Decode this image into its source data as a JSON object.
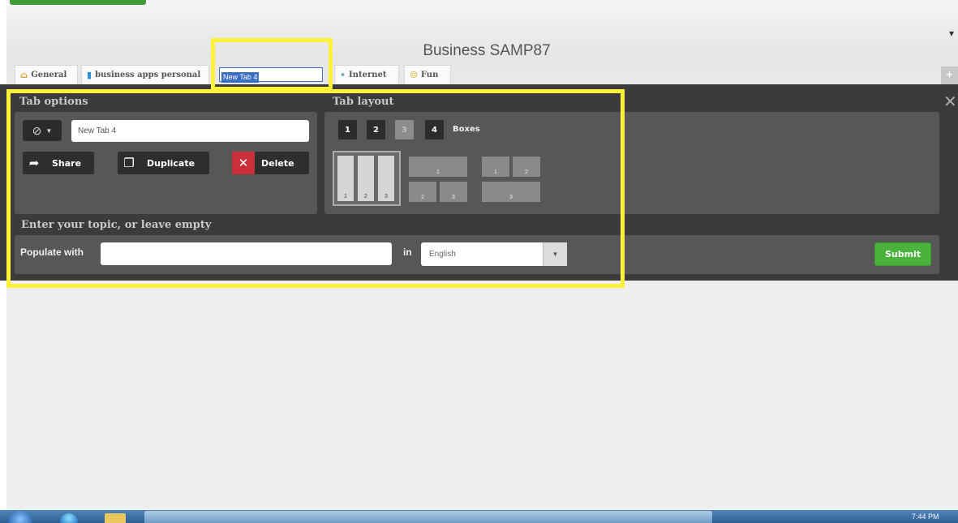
{
  "page": {
    "title": "Business SAMP87"
  },
  "tabs": [
    {
      "label": "General",
      "icon": "home-icon"
    },
    {
      "label": "business apps personal",
      "icon": "chart-icon"
    },
    {
      "label": "Internet",
      "icon": "dot-icon"
    },
    {
      "label": "Fun",
      "icon": "smiley-icon"
    }
  ],
  "editing_tab": {
    "value": "New Tab 4"
  },
  "tab_options": {
    "heading": "Tab options",
    "name_value": "New Tab 4",
    "share_label": "Share",
    "duplicate_label": "Duplicate",
    "delete_label": "Delete"
  },
  "tab_layout": {
    "heading": "Tab layout",
    "columns": [
      "1",
      "2",
      "3",
      "4"
    ],
    "selected_columns": "3",
    "boxes_label": "Boxes",
    "layout_a": [
      "1",
      "2",
      "3"
    ],
    "layout_b": [
      "1",
      "2",
      "3"
    ],
    "layout_c": [
      "1",
      "2",
      "3"
    ]
  },
  "populate": {
    "heading": "Enter your topic, or leave empty",
    "label": "Populate with",
    "value": "",
    "in_label": "in",
    "language": "English",
    "submit_label": "Submit"
  },
  "taskbar": {
    "clock": "7:44 PM"
  },
  "colors": {
    "highlight": "#fff03a",
    "submit": "#49b23a",
    "panel": "#3b3b3b"
  }
}
